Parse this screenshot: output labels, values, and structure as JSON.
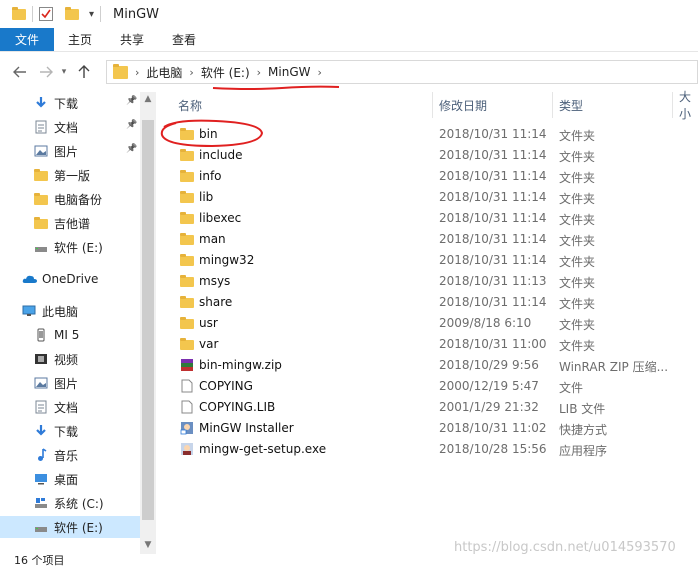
{
  "window": {
    "title": "MinGW"
  },
  "ribbon": {
    "tabs": [
      "文件",
      "主页",
      "共享",
      "查看"
    ]
  },
  "address": {
    "crumbs": [
      "此电脑",
      "软件 (E:)",
      "MinGW"
    ],
    "chevron_icon": "chevron-right-icon"
  },
  "sidebar": {
    "items": [
      {
        "label": "下载",
        "icon": "download-icon",
        "pinned": true
      },
      {
        "label": "文档",
        "icon": "document-icon",
        "pinned": true
      },
      {
        "label": "图片",
        "icon": "pictures-icon",
        "pinned": true
      },
      {
        "label": "第一版",
        "icon": "folder-icon",
        "pinned": false
      },
      {
        "label": "电脑备份",
        "icon": "folder-icon",
        "pinned": false
      },
      {
        "label": "吉他谱",
        "icon": "folder-icon",
        "pinned": false
      },
      {
        "label": "软件 (E:)",
        "icon": "drive-icon",
        "pinned": false
      },
      {
        "label": "OneDrive",
        "icon": "onedrive-icon",
        "pinned": false
      },
      {
        "label": "此电脑",
        "icon": "computer-icon",
        "pinned": false
      },
      {
        "label": "MI 5",
        "icon": "phone-icon",
        "pinned": false
      },
      {
        "label": "视频",
        "icon": "video-icon",
        "pinned": false
      },
      {
        "label": "图片",
        "icon": "pictures-icon",
        "pinned": false
      },
      {
        "label": "文档",
        "icon": "document-icon",
        "pinned": false
      },
      {
        "label": "下载",
        "icon": "download-icon",
        "pinned": false
      },
      {
        "label": "音乐",
        "icon": "music-icon",
        "pinned": false
      },
      {
        "label": "桌面",
        "icon": "desktop-icon",
        "pinned": false
      },
      {
        "label": "系统 (C:)",
        "icon": "system-drive-icon",
        "pinned": false
      },
      {
        "label": "软件 (E:)",
        "icon": "drive-icon",
        "pinned": false
      }
    ],
    "selected_label": "软件 (E:)"
  },
  "columns": {
    "name": "名称",
    "date": "修改日期",
    "type": "类型",
    "size": "大小"
  },
  "files": [
    {
      "name": "bin",
      "date": "2018/10/31 11:14",
      "type": "文件夹",
      "icon": "folder-icon"
    },
    {
      "name": "include",
      "date": "2018/10/31 11:14",
      "type": "文件夹",
      "icon": "folder-icon"
    },
    {
      "name": "info",
      "date": "2018/10/31 11:14",
      "type": "文件夹",
      "icon": "folder-icon"
    },
    {
      "name": "lib",
      "date": "2018/10/31 11:14",
      "type": "文件夹",
      "icon": "folder-icon"
    },
    {
      "name": "libexec",
      "date": "2018/10/31 11:14",
      "type": "文件夹",
      "icon": "folder-icon"
    },
    {
      "name": "man",
      "date": "2018/10/31 11:14",
      "type": "文件夹",
      "icon": "folder-icon"
    },
    {
      "name": "mingw32",
      "date": "2018/10/31 11:14",
      "type": "文件夹",
      "icon": "folder-icon"
    },
    {
      "name": "msys",
      "date": "2018/10/31 11:13",
      "type": "文件夹",
      "icon": "folder-icon"
    },
    {
      "name": "share",
      "date": "2018/10/31 11:14",
      "type": "文件夹",
      "icon": "folder-icon"
    },
    {
      "name": "usr",
      "date": "2009/8/18 6:10",
      "type": "文件夹",
      "icon": "folder-icon"
    },
    {
      "name": "var",
      "date": "2018/10/31 11:00",
      "type": "文件夹",
      "icon": "folder-icon"
    },
    {
      "name": "bin-mingw.zip",
      "date": "2018/10/29 9:56",
      "type": "WinRAR ZIP 压缩...",
      "icon": "winrar-archive-icon"
    },
    {
      "name": "COPYING",
      "date": "2000/12/19 5:47",
      "type": "文件",
      "icon": "file-icon"
    },
    {
      "name": "COPYING.LIB",
      "date": "2001/1/29 21:32",
      "type": "LIB 文件",
      "icon": "file-icon"
    },
    {
      "name": "MinGW Installer",
      "date": "2018/10/31 11:02",
      "type": "快捷方式",
      "icon": "shortcut-icon"
    },
    {
      "name": "mingw-get-setup.exe",
      "date": "2018/10/28 15:56",
      "type": "应用程序",
      "icon": "installer-icon"
    }
  ],
  "status": {
    "item_count": "16 个项目"
  },
  "watermark": "https://blog.csdn.net/u014593570",
  "colors": {
    "accent": "#1979ca",
    "selection": "#cce8ff",
    "annotation": "#e02020",
    "folder": "#f3c64e"
  }
}
